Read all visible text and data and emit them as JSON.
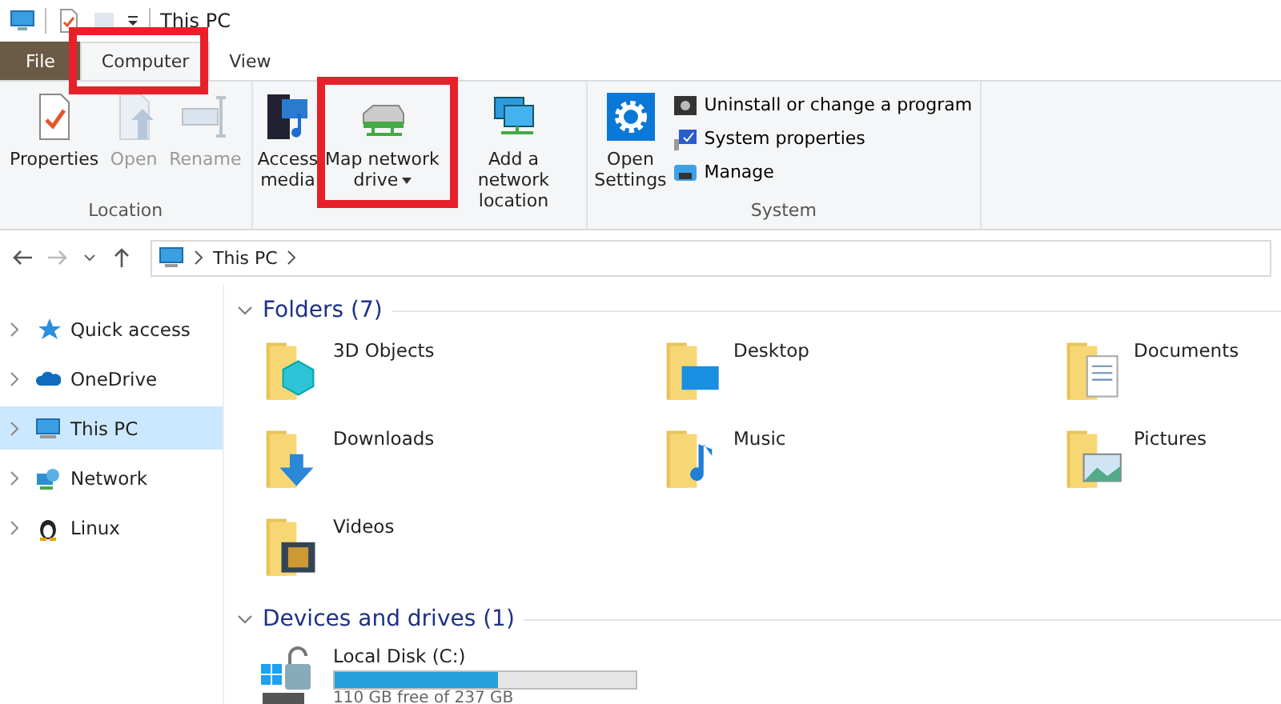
{
  "window": {
    "title": "This PC"
  },
  "ribbon_tabs": [
    {
      "label": "File",
      "kind": "file",
      "selected": false
    },
    {
      "label": "Computer",
      "kind": "tab",
      "selected": true
    },
    {
      "label": "View",
      "kind": "tab",
      "selected": false
    }
  ],
  "ribbon_groups": [
    {
      "label": "Location",
      "large_buttons": [
        {
          "label": "Properties",
          "kind": "properties",
          "disabled": false
        },
        {
          "label": "Open",
          "kind": "open",
          "disabled": true
        },
        {
          "label": "Rename",
          "kind": "rename",
          "disabled": true
        }
      ]
    },
    {
      "large_buttons": [
        {
          "label": "Access media",
          "kind": "media",
          "disabled": false
        },
        {
          "label": "Map network drive",
          "kind": "mapdrive",
          "disabled": false,
          "dropdown": true
        },
        {
          "label": "Add a network location",
          "kind": "netloc",
          "disabled": false
        }
      ]
    },
    {
      "label": "System",
      "large_buttons": [
        {
          "label": "Open Settings",
          "kind": "settings",
          "disabled": false
        }
      ],
      "small_buttons": [
        {
          "label": "Uninstall or change a program",
          "kind": "uninstall"
        },
        {
          "label": "System properties",
          "kind": "sysprops"
        },
        {
          "label": "Manage",
          "kind": "manage"
        }
      ]
    }
  ],
  "address_bar": {
    "path": "This PC"
  },
  "sidebar": {
    "items": [
      {
        "label": "Quick access",
        "kind": "star",
        "selected": false
      },
      {
        "label": "OneDrive",
        "kind": "cloud",
        "selected": false
      },
      {
        "label": "This PC",
        "kind": "pc",
        "selected": true
      },
      {
        "label": "Network",
        "kind": "network",
        "selected": false
      },
      {
        "label": "Linux",
        "kind": "linux",
        "selected": false
      }
    ]
  },
  "folders": {
    "heading": "Folders (7)",
    "items": [
      {
        "label": "3D Objects",
        "kind": "cube"
      },
      {
        "label": "Desktop",
        "kind": "desktop"
      },
      {
        "label": "Documents",
        "kind": "documents"
      },
      {
        "label": "Downloads",
        "kind": "download"
      },
      {
        "label": "Music",
        "kind": "music"
      },
      {
        "label": "Pictures",
        "kind": "pictures"
      },
      {
        "label": "Videos",
        "kind": "videos"
      }
    ]
  },
  "devices": {
    "heading": "Devices and drives (1)",
    "items": [
      {
        "label": "Local Disk (C:)",
        "level": 0.54,
        "reading": "110 GB free of 237 GB"
      }
    ]
  }
}
